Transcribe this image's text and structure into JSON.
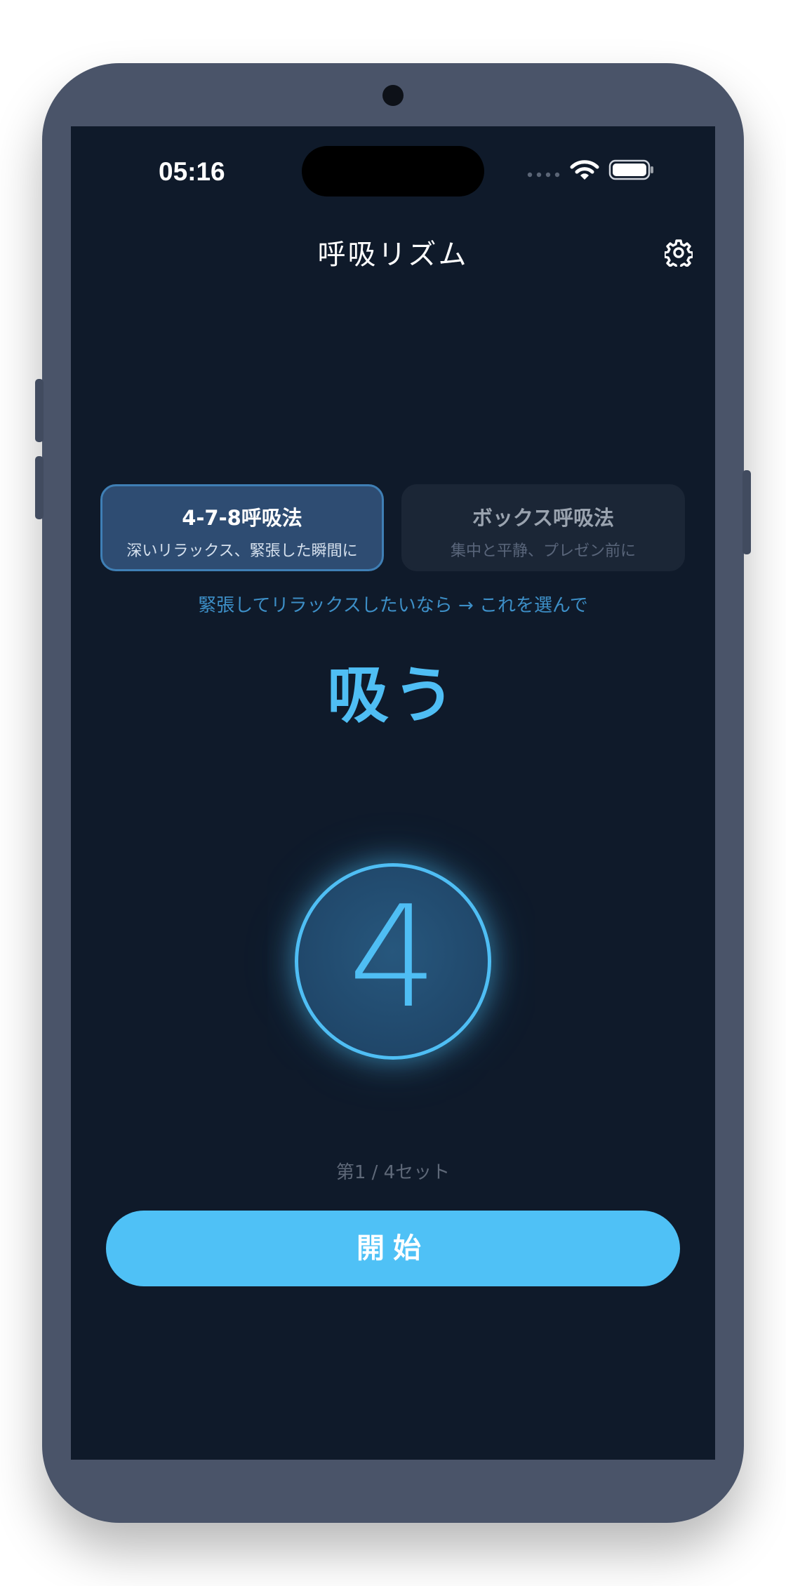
{
  "status_bar": {
    "time": "05:16"
  },
  "header": {
    "title": "呼吸リズム",
    "settings_icon": "gear-icon"
  },
  "modes": [
    {
      "name": "4-7-8呼吸法",
      "description": "深いリラックス、緊張した瞬間に",
      "selected": true
    },
    {
      "name": "ボックス呼吸法",
      "description": "集中と平静、プレゼン前に",
      "selected": false
    }
  ],
  "hint": "緊張してリラックスしたいなら → これを選んで",
  "phase": "吸う",
  "countdown": "4",
  "set_progress": "第1 / 4セット",
  "start_button": "開始",
  "colors": {
    "background": "#0f1a2a",
    "accent": "#4fbef4",
    "selected_card": "#2e4c72",
    "unselected_card": "#1b2636"
  }
}
